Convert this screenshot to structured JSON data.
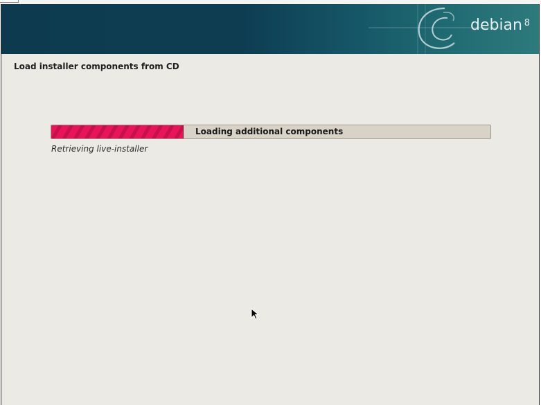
{
  "banner": {
    "logo_text": "debian",
    "logo_version": "8"
  },
  "page": {
    "title": "Load installer components from CD"
  },
  "progress": {
    "label": "Loading additional components",
    "status": "Retrieving live-installer",
    "fraction": 0.3
  },
  "colors": {
    "banner": "#0e3d52",
    "progress_fill": "#e8145a",
    "progress_track": "#d9d2c6",
    "background": "#eceae4"
  },
  "icons": {
    "logo": "debian-swirl-icon",
    "pointer": "mouse-pointer-icon"
  }
}
